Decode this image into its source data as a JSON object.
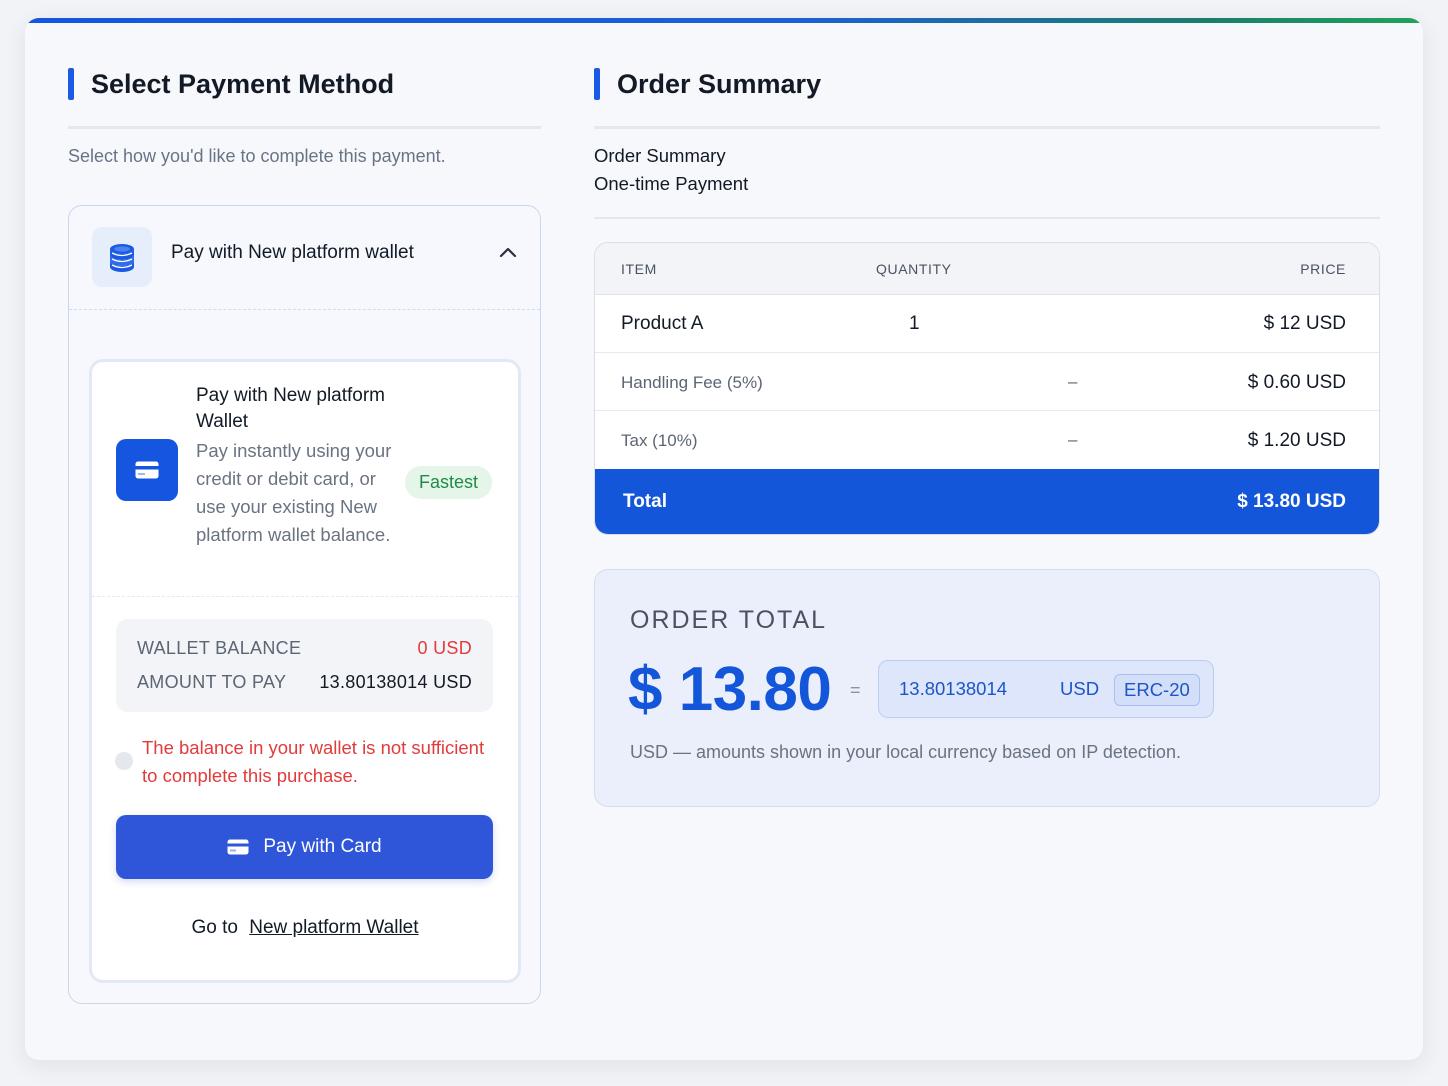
{
  "left": {
    "title": "Select Payment Method",
    "subtitle": "Select how you'd like to complete this payment.",
    "method": {
      "title": "Pay with New platform wallet",
      "icon": "coins-stack-icon",
      "option": {
        "title": "Pay with New platform Wallet",
        "description": "Pay instantly using your credit or debit card, or use your existing New platform wallet balance.",
        "badge": "Fastest",
        "icon": "credit-card-icon"
      },
      "balance": {
        "wallet_label": "WALLET BALANCE",
        "wallet_value": "0 USD",
        "amount_label": "AMOUNT TO PAY",
        "amount_value": "13.80138014 USD"
      },
      "error": "The balance in your wallet is not sufficient to complete this purchase.",
      "pay_button": "Pay with Card",
      "goto_prefix": "Go to",
      "goto_link": "New platform Wallet"
    }
  },
  "right": {
    "title": "Order Summary",
    "summary_line1": "Order Summary",
    "summary_line2": "One-time Payment",
    "table": {
      "headers": {
        "item": "ITEM",
        "quantity": "QUANTITY",
        "price": "PRICE"
      },
      "rows": [
        {
          "item": "Product A",
          "quantity": "1",
          "price": "$ 12 USD"
        },
        {
          "item": "Handling Fee (5%)",
          "quantity": "–",
          "price": "$ 0.60 USD"
        },
        {
          "item": "Tax (10%)",
          "quantity": "–",
          "price": "$ 1.20 USD"
        }
      ],
      "total_label": "Total",
      "total_value": "$ 13.80 USD"
    },
    "order_total": {
      "label": "ORDER TOTAL",
      "amount": "$ 13.80",
      "equals": "=",
      "crypto_amount": "13.80138014",
      "crypto_currency": "USD",
      "crypto_network": "ERC-20",
      "note": "USD — amounts shown in your local currency based on IP detection."
    }
  },
  "colors": {
    "accent": "#1456d9",
    "button": "#2f56d9",
    "error": "#e23b3b",
    "success": "#1f8c45"
  }
}
